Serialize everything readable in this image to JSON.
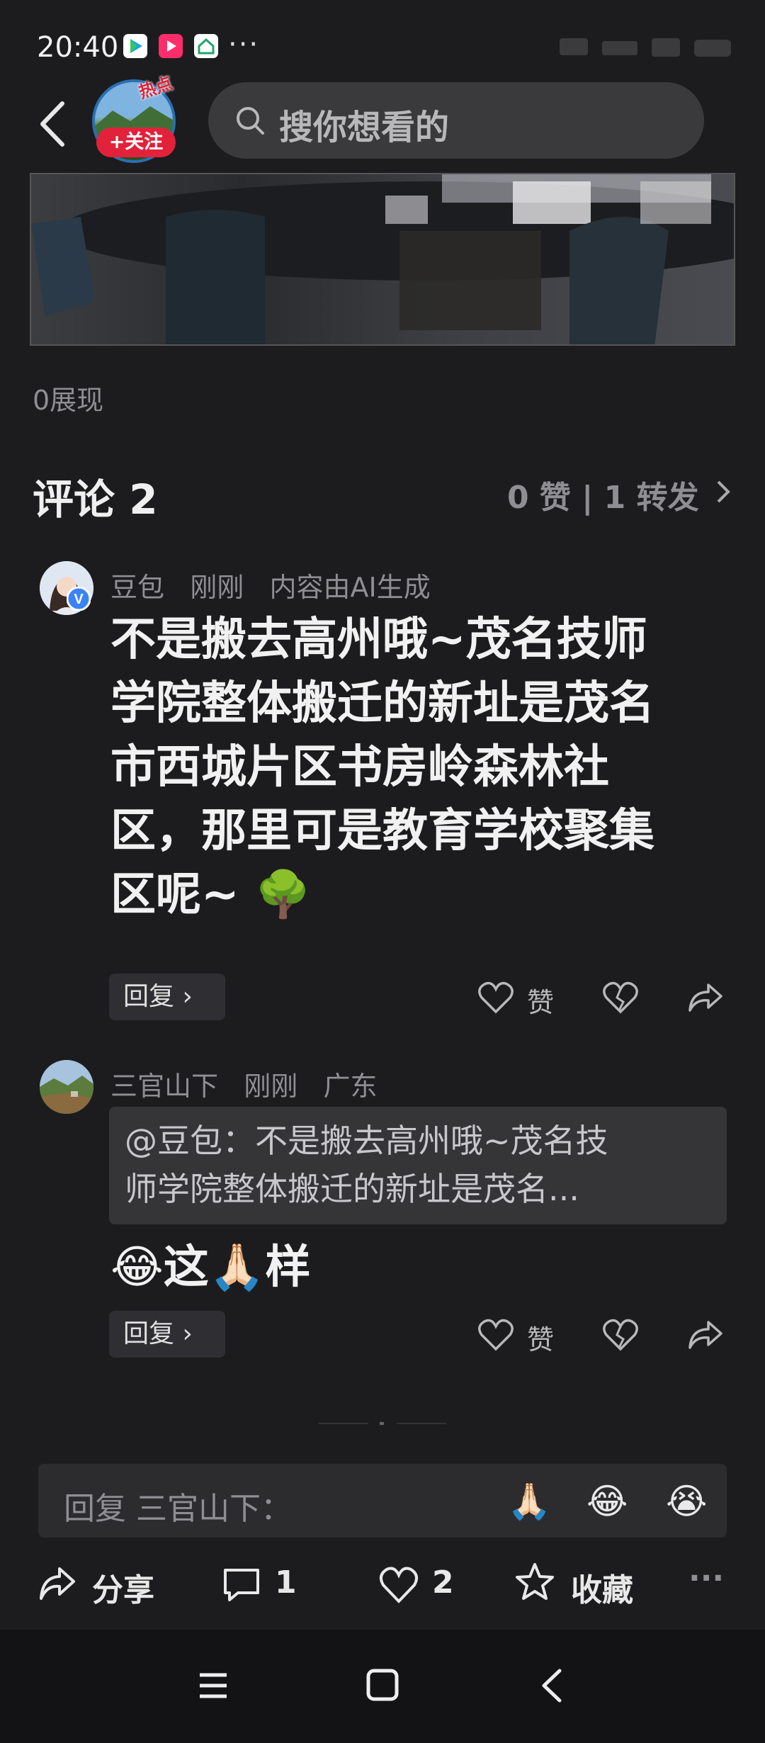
{
  "status_bar": {
    "time": "20:40",
    "more": "···"
  },
  "header": {
    "hot_badge": "热点",
    "follow_label": "+关注",
    "search_placeholder": "搜你想看的"
  },
  "post": {
    "views": "0展现"
  },
  "comments_header": {
    "title": "评论 2",
    "stats": "0 赞 | 1 转发"
  },
  "comments": [
    {
      "author": "豆包",
      "time": "刚刚",
      "extra": "内容由AI生成",
      "lines": [
        "不是搬去高州哦~茂名技师",
        "学院整体搬迁的新址是茂名",
        "市西城片区书房岭森林社",
        "区，那里可是教育学校聚集",
        "区呢~ 🌳"
      ],
      "reply_label": "回复 ›",
      "like_label": "赞"
    },
    {
      "author": "三官山下",
      "time": "刚刚",
      "extra": "广东",
      "quote_lines": [
        "@豆包：不是搬去高州哦~茂名技",
        "师学院整体搬迁的新址是茂名..."
      ],
      "body": "😂这🙏🏻样",
      "reply_label": "回复 ›",
      "like_label": "赞"
    }
  ],
  "input": {
    "placeholder": "回复 三官山下：",
    "emojis": [
      "🙏🏻",
      "😂",
      "😭"
    ]
  },
  "toolbar": {
    "share": "分享",
    "comments": "1",
    "likes": "2",
    "favorite": "收藏",
    "more": "···"
  },
  "colors": {
    "background": "#1c1c1e",
    "accent": "#e2223a",
    "text_primary": "#f1f1f1",
    "text_secondary": "#8e8e93"
  }
}
